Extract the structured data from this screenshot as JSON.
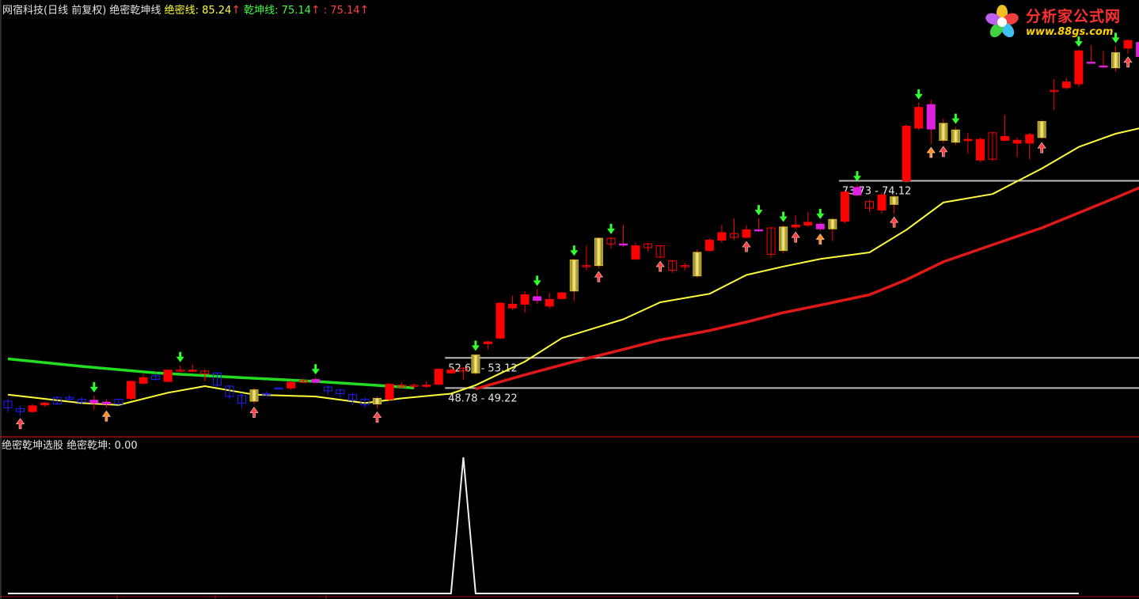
{
  "header_top": {
    "title": "网宿科技(日线 前复权) 绝密乾坤线",
    "line1_label": "绝密线: 85.24",
    "line2_label": "乾坤线: 75.14",
    "line3_label": ": 75.14",
    "arrow": "↑"
  },
  "header_bottom": {
    "title": "绝密乾坤选股",
    "value_label": "绝密乾坤: 0.00"
  },
  "logo": {
    "text": "分析家公式网",
    "url": "www.88gs.com"
  },
  "colors": {
    "up": "#ff0000",
    "down": "#2020ff",
    "yellow_line": "#ffff3a",
    "red_line": "#e01818",
    "green_line": "#22dd22",
    "magenta": "#e020e0",
    "gold": "#d8c030",
    "divider": "#a01010"
  },
  "chart_data": [
    {
      "type": "candlestick",
      "ylim": [
        46.0,
        86.5
      ],
      "candles": [
        [
          0,
          48.1,
          47.4,
          48.3,
          46.9,
          "down"
        ],
        [
          1,
          47.3,
          47.0,
          47.6,
          46.6,
          "down"
        ],
        [
          2,
          47.0,
          47.6,
          47.8,
          46.9,
          "up"
        ],
        [
          3,
          47.7,
          47.9,
          48.0,
          47.5,
          "up"
        ],
        [
          4,
          47.8,
          48.5,
          48.6,
          47.7,
          "down"
        ],
        [
          5,
          48.5,
          48.3,
          48.8,
          48.1,
          "down"
        ],
        [
          6,
          48.3,
          48.0,
          48.5,
          47.8,
          "down"
        ],
        [
          7,
          47.9,
          48.2,
          48.7,
          47.2,
          "ma"
        ],
        [
          8,
          48.0,
          47.8,
          48.3,
          47.4,
          "ma"
        ],
        [
          9,
          48.3,
          47.8,
          48.4,
          47.7,
          "down"
        ],
        [
          10,
          48.4,
          50.2,
          50.3,
          48.2,
          "up"
        ],
        [
          11,
          50.0,
          50.6,
          51.0,
          49.9,
          "up"
        ],
        [
          12,
          50.4,
          50.8,
          51.1,
          50.3,
          "down"
        ],
        [
          13,
          50.2,
          51.4,
          51.5,
          50.1,
          "up"
        ],
        [
          14,
          51.4,
          51.3,
          51.9,
          51.2,
          "up"
        ],
        [
          15,
          51.3,
          51.4,
          52.0,
          51.2,
          "up"
        ],
        [
          16,
          51.3,
          51.0,
          51.5,
          50.2,
          "up"
        ],
        [
          17,
          51.1,
          49.8,
          51.2,
          49.6,
          "down"
        ],
        [
          18,
          49.7,
          48.6,
          49.8,
          48.3,
          "down"
        ],
        [
          19,
          48.7,
          47.9,
          49.0,
          47.4,
          "down"
        ],
        [
          20,
          48.1,
          49.3,
          49.5,
          47.8,
          "gold"
        ],
        [
          21,
          48.9,
          48.8,
          49.1,
          48.6,
          "down"
        ],
        [
          22,
          49.5,
          49.5,
          49.6,
          49.4,
          "down"
        ],
        [
          23,
          49.5,
          50.1,
          50.3,
          49.3,
          "up"
        ],
        [
          24,
          50.3,
          50.1,
          50.5,
          50.0,
          "up"
        ],
        [
          25,
          50.4,
          50.1,
          50.6,
          50.0,
          "ma"
        ],
        [
          26,
          49.6,
          49.2,
          49.8,
          48.8,
          "down"
        ],
        [
          27,
          49.3,
          48.9,
          49.4,
          48.5,
          "down"
        ],
        [
          28,
          48.8,
          48.2,
          49.0,
          47.7,
          "down"
        ],
        [
          29,
          48.3,
          47.7,
          48.5,
          47.4,
          "down"
        ],
        [
          30,
          47.8,
          48.4,
          48.6,
          47.3,
          "gold"
        ],
        [
          31,
          48.3,
          49.9,
          50.0,
          48.1,
          "up"
        ],
        [
          32,
          49.8,
          49.6,
          50.1,
          49.5,
          "up"
        ],
        [
          33,
          49.8,
          49.7,
          50.0,
          49.4,
          "up"
        ],
        [
          34,
          49.8,
          49.8,
          50.2,
          49.5,
          "up"
        ],
        [
          35,
          49.9,
          51.5,
          51.5,
          49.8,
          "up"
        ],
        [
          36,
          51.1,
          51.4,
          51.8,
          51.0,
          "up"
        ],
        [
          37,
          51.6,
          51.3,
          51.7,
          50.4,
          "up"
        ],
        [
          38,
          51.1,
          53.0,
          53.1,
          50.9,
          "gold"
        ],
        [
          39,
          54.2,
          54.4,
          54.5,
          53.6,
          "up"
        ],
        [
          40,
          54.8,
          58.5,
          58.6,
          54.7,
          "up"
        ],
        [
          41,
          58.0,
          58.4,
          59.3,
          57.8,
          "up"
        ],
        [
          42,
          58.4,
          59.4,
          59.8,
          57.5,
          "up"
        ],
        [
          43,
          58.8,
          59.2,
          60.0,
          58.4,
          "ma"
        ],
        [
          44,
          58.2,
          58.9,
          59.6,
          57.9,
          "up"
        ],
        [
          45,
          59.0,
          59.6,
          59.7,
          58.9,
          "up"
        ],
        [
          46,
          59.8,
          63.1,
          63.2,
          58.7,
          "gold"
        ],
        [
          47,
          62.5,
          62.4,
          64.6,
          62.0,
          "up"
        ],
        [
          48,
          62.5,
          65.4,
          65.5,
          62.2,
          "gold"
        ],
        [
          49,
          65.4,
          64.8,
          65.5,
          64.3,
          "up"
        ],
        [
          50,
          64.8,
          64.8,
          66.8,
          64.5,
          "ma"
        ],
        [
          51,
          63.2,
          64.6,
          64.9,
          63.1,
          "up"
        ],
        [
          52,
          64.8,
          64.4,
          64.9,
          64.0,
          "up"
        ],
        [
          53,
          64.6,
          63.4,
          64.7,
          63.3,
          "up"
        ],
        [
          54,
          63.0,
          62.0,
          63.1,
          61.7,
          "up"
        ],
        [
          55,
          62.5,
          62.4,
          62.8,
          62.0,
          "up"
        ],
        [
          56,
          61.4,
          63.9,
          64.2,
          61.2,
          "gold"
        ],
        [
          57,
          64.1,
          65.2,
          65.4,
          64.0,
          "up"
        ],
        [
          58,
          65.2,
          66.0,
          66.8,
          64.9,
          "up"
        ],
        [
          59,
          65.9,
          65.5,
          67.5,
          65.2,
          "up"
        ],
        [
          60,
          65.5,
          66.3,
          66.8,
          65.4,
          "up"
        ],
        [
          61,
          66.3,
          66.2,
          67.5,
          66.1,
          "ma"
        ],
        [
          62,
          66.5,
          63.7,
          66.6,
          63.3,
          "up"
        ],
        [
          63,
          64.1,
          66.6,
          66.8,
          63.8,
          "gold"
        ],
        [
          64,
          66.6,
          66.8,
          67.8,
          66.4,
          "up"
        ],
        [
          65,
          66.8,
          67.1,
          68.2,
          66.6,
          "up"
        ],
        [
          66,
          66.9,
          66.4,
          67.1,
          66.2,
          "ma"
        ],
        [
          67,
          66.4,
          67.4,
          67.6,
          65.1,
          "gold"
        ],
        [
          68,
          67.2,
          70.3,
          70.5,
          67.0,
          "up"
        ],
        [
          69,
          70.0,
          70.8,
          71.1,
          69.8,
          "ma"
        ],
        [
          70,
          69.3,
          68.6,
          69.5,
          68.2,
          "up"
        ],
        [
          71,
          68.4,
          70.0,
          70.3,
          68.0,
          "up"
        ],
        [
          72,
          69.0,
          69.8,
          70.0,
          68.0,
          "gold"
        ],
        [
          73,
          71.5,
          77.3,
          77.5,
          71.3,
          "up"
        ],
        [
          74,
          77.1,
          79.3,
          79.8,
          76.9,
          "up"
        ],
        [
          75,
          79.6,
          77.0,
          80.1,
          75.4,
          "ma"
        ],
        [
          76,
          75.8,
          77.6,
          78.1,
          75.5,
          "gold"
        ],
        [
          77,
          76.9,
          75.6,
          77.2,
          75.3,
          "gold"
        ],
        [
          78,
          75.8,
          75.9,
          76.6,
          74.4,
          "up"
        ],
        [
          79,
          73.7,
          75.9,
          76.1,
          73.5,
          "up"
        ],
        [
          80,
          76.6,
          73.8,
          76.7,
          73.6,
          "up"
        ],
        [
          81,
          75.8,
          76.2,
          78.5,
          75.7,
          "up"
        ],
        [
          82,
          75.5,
          75.8,
          76.1,
          74.0,
          "up"
        ],
        [
          83,
          75.5,
          76.4,
          76.6,
          73.8,
          "up"
        ],
        [
          84,
          76.1,
          77.8,
          78.0,
          75.9,
          "gold"
        ],
        [
          85,
          81.1,
          81.0,
          82.3,
          79.0,
          "up"
        ],
        [
          86,
          81.4,
          82.0,
          82.4,
          81.2,
          "up"
        ],
        [
          87,
          81.8,
          85.3,
          85.4,
          81.5,
          "up"
        ],
        [
          88,
          84.1,
          84.1,
          85.9,
          84.0,
          "ma"
        ],
        [
          89,
          83.6,
          83.7,
          85.3,
          83.5,
          "ma"
        ],
        [
          90,
          83.5,
          85.1,
          85.8,
          83.1,
          "gold"
        ],
        [
          91,
          85.6,
          86.4,
          86.5,
          85.0,
          "up"
        ],
        [
          92,
          86.2,
          84.7,
          86.9,
          84.5,
          "ma"
        ],
        [
          93,
          83.1,
          81.4,
          84.0,
          81.2,
          "up"
        ],
        [
          94,
          84.5,
          81.5,
          84.7,
          81.3,
          "up"
        ]
      ],
      "down_arrows": [
        7,
        14,
        25,
        38,
        43,
        46,
        49,
        61,
        63,
        66,
        69,
        74,
        77,
        87,
        90
      ],
      "up_arrows": [
        1,
        8,
        20,
        30,
        48,
        53,
        60,
        64,
        66,
        72,
        75,
        76,
        84,
        91
      ],
      "yellow_line": [
        [
          0,
          48.8
        ],
        [
          6,
          47.9
        ],
        [
          9,
          47.7
        ],
        [
          13,
          49.0
        ],
        [
          16,
          49.7
        ],
        [
          20,
          48.8
        ],
        [
          25,
          48.6
        ],
        [
          29,
          47.9
        ],
        [
          32,
          48.4
        ],
        [
          36,
          48.9
        ],
        [
          38,
          49.8
        ],
        [
          42,
          52.3
        ],
        [
          45,
          54.8
        ],
        [
          50,
          56.8
        ],
        [
          53,
          58.6
        ],
        [
          57,
          59.5
        ],
        [
          60,
          61.5
        ],
        [
          63,
          62.4
        ],
        [
          66,
          63.2
        ],
        [
          70,
          63.9
        ],
        [
          73,
          66.3
        ],
        [
          76,
          69.2
        ],
        [
          80,
          70.1
        ],
        [
          84,
          72.8
        ],
        [
          87,
          75.1
        ],
        [
          90,
          76.5
        ],
        [
          92,
          77.1
        ],
        [
          94,
          77.7
        ]
      ],
      "red_line": [
        [
          38,
          49.4
        ],
        [
          42,
          50.9
        ],
        [
          46,
          52.3
        ],
        [
          50,
          53.6
        ],
        [
          53,
          54.6
        ],
        [
          57,
          55.6
        ],
        [
          60,
          56.5
        ],
        [
          63,
          57.5
        ],
        [
          66,
          58.3
        ],
        [
          70,
          59.4
        ],
        [
          73,
          61.0
        ],
        [
          76,
          62.9
        ],
        [
          80,
          64.7
        ],
        [
          84,
          66.5
        ],
        [
          87,
          68.1
        ],
        [
          90,
          69.7
        ],
        [
          92,
          70.8
        ],
        [
          94,
          71.7
        ]
      ],
      "green_line": [
        [
          0,
          52.6
        ],
        [
          6,
          51.8
        ],
        [
          12,
          51.1
        ],
        [
          19,
          50.6
        ],
        [
          25,
          50.2
        ],
        [
          31,
          49.7
        ],
        [
          33,
          49.5
        ]
      ],
      "levels": [
        {
          "label": "48.78 - 49.22",
          "value": 49.5,
          "x_start": 35
        },
        {
          "label": "52.69 - 53.12",
          "value": 52.7,
          "x_start": 35
        },
        {
          "label": "73.73 - 74.12",
          "value": 71.5,
          "x_start": 67
        }
      ]
    },
    {
      "type": "line",
      "title": "绝密乾坤选股",
      "ylim": [
        0,
        1
      ],
      "series": [
        {
          "name": "绝密乾坤",
          "points": [
            [
              0,
              0
            ],
            [
              36,
              0
            ],
            [
              37,
              1
            ],
            [
              38,
              0
            ],
            [
              87,
              0
            ]
          ]
        }
      ]
    }
  ]
}
